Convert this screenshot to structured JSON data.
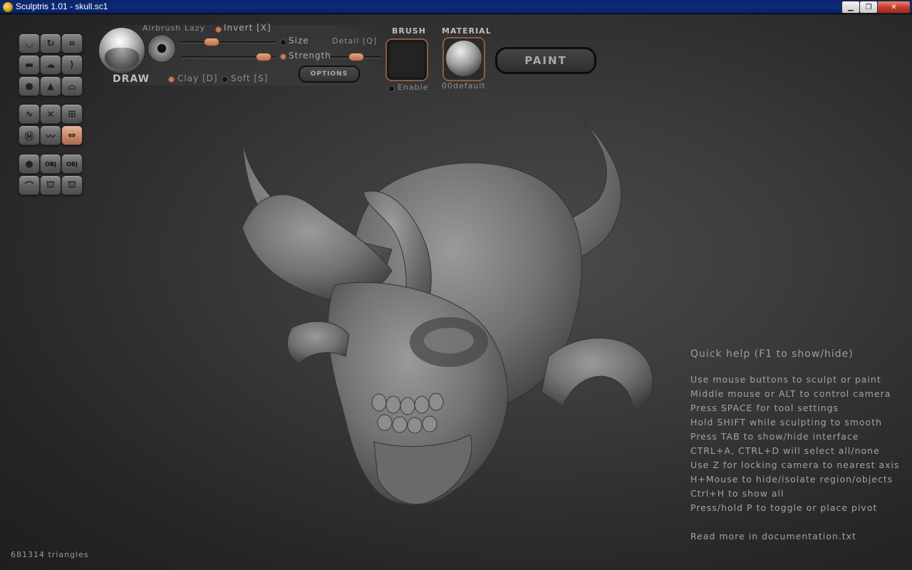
{
  "window": {
    "title": "Sculptris 1.01 - skull.sc1",
    "icon": "sculptris-app-icon"
  },
  "window_controls": [
    "minimize",
    "maximize",
    "close"
  ],
  "tool_palette": {
    "group1": [
      "crease-icon",
      "rotate-icon",
      "scale-icon",
      "flatten-icon",
      "inflate-icon",
      "pinch-icon",
      "grab-icon",
      "smooth-icon",
      "reduce-icon"
    ],
    "group2": [
      "symmetry-icon",
      "wireframe-icon",
      "grid-icon",
      "mask-icon",
      "wave-icon",
      "move-arrows-icon"
    ],
    "group3": [
      "sphere-icon",
      "import-obj-icon",
      "export-obj-icon",
      "plane-icon",
      "open-file-icon",
      "save-file-icon"
    ],
    "active": "move-arrows-icon",
    "obj_label": "OBJ"
  },
  "toolbar": {
    "tool_name": "DRAW",
    "airbrush": "Airbrush",
    "lazy": "Lazy",
    "invert": "Invert [X]",
    "size": "Size",
    "strength": "Strength",
    "detail": "Detail [Q]",
    "clay": "Clay [D]",
    "soft": "Soft [S]",
    "options": "OPTIONS",
    "brush_heading": "BRUSH",
    "enable": "Enable",
    "material_heading": "MATERIAL",
    "material_name": "00default",
    "paint": "PAINT"
  },
  "colors": {
    "accent": "#c07a5c",
    "title_bar": "#0a246a"
  },
  "quick_help": {
    "title": "Quick help (F1 to show/hide)",
    "lines": [
      "Use mouse buttons to sculpt or paint",
      "Middle mouse or ALT to control camera",
      "Press SPACE for tool settings",
      "Hold SHIFT while sculpting to smooth",
      "Press TAB to show/hide interface",
      "CTRL+A, CTRL+D will select all/none",
      "Use Z for locking camera to nearest axis",
      "H+Mouse to hide/isolate region/objects",
      "Ctrl+H to show all",
      "Press/hold P to toggle or place pivot"
    ],
    "footer": "Read more in documentation.txt"
  },
  "status": {
    "triangles": "681314 triangles"
  }
}
